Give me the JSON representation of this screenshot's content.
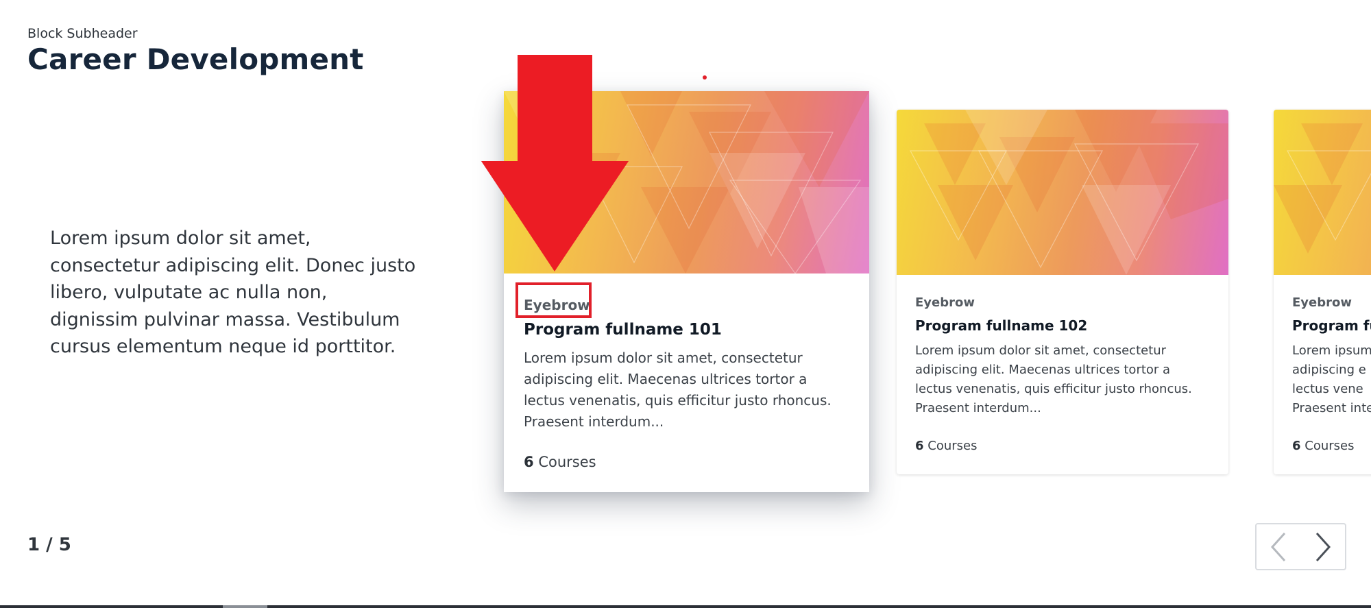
{
  "block": {
    "subheader": "Block Subheader",
    "title": "Career Development",
    "intro": "Lorem ipsum dolor sit amet, consectetur adipiscing elit. Donec justo libero, vulputate ac nulla non, dignissim pulvinar massa. Vestibulum cursus elementum neque id porttitor."
  },
  "cards": [
    {
      "eyebrow": "Eyebrow",
      "name": "Program fullname 101",
      "description": "Lorem ipsum dolor sit amet, consectetur adipiscing elit. Maecenas ultrices tortor a lectus venenatis, quis efficitur justo rhoncus. Praesent interdum...",
      "course_count": "6",
      "course_label": "Courses"
    },
    {
      "eyebrow": "Eyebrow",
      "name": "Program fullname 102",
      "description": "Lorem ipsum dolor sit amet, consectetur adipiscing elit. Maecenas ultrices tortor a lectus venenatis, quis efficitur justo rhoncus. Praesent interdum...",
      "course_count": "6",
      "course_label": "Courses"
    },
    {
      "eyebrow": "Eyebrow",
      "name": "Program fu",
      "description_lines": [
        "Lorem ipsum",
        "adipiscing e",
        "lectus vene",
        "Praesent inte"
      ],
      "course_count": "6",
      "course_label": "Courses"
    }
  ],
  "pagination": {
    "text": "1 / 5"
  },
  "icons": {
    "prev": "chevron-left-icon",
    "next": "chevron-right-icon",
    "annotation": "red-down-arrow"
  },
  "colors": {
    "annotation_red": "#e1202a",
    "title": "#16263a"
  }
}
